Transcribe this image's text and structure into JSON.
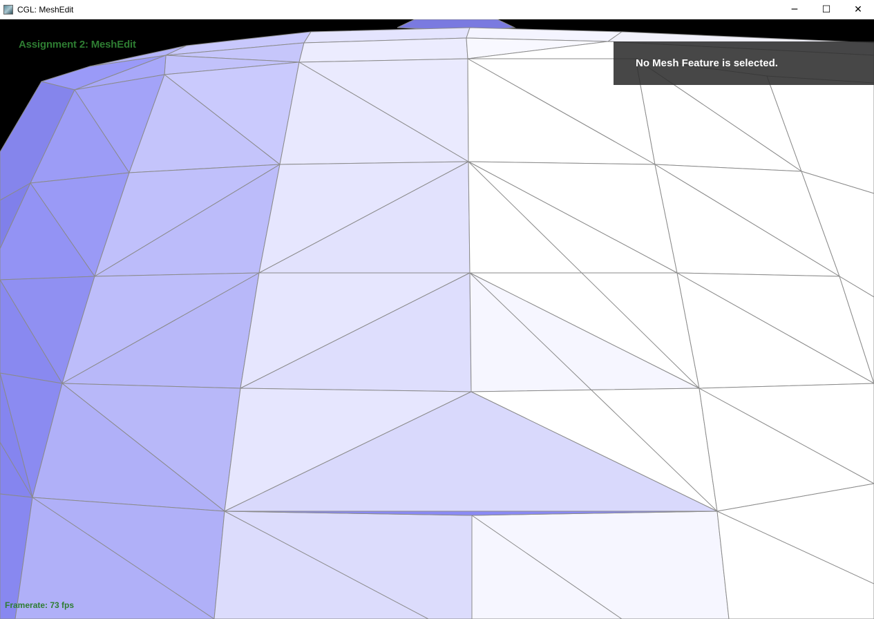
{
  "window": {
    "title": "CGL: MeshEdit",
    "icon": "app-icon",
    "controls": {
      "minimize": "─",
      "maximize": "☐",
      "close": "✕"
    }
  },
  "viewport": {
    "heading": "Assignment 2: MeshEdit",
    "info_message": "No Mesh Feature is selected.",
    "framerate": "Framerate: 73 fps",
    "colors": {
      "background": "#000000",
      "text_accent": "#2e7d32",
      "mesh_edge": "#8a8a8a",
      "mesh_shade_dark": "#8a8af5",
      "mesh_shade_light": "#ffffff"
    }
  }
}
